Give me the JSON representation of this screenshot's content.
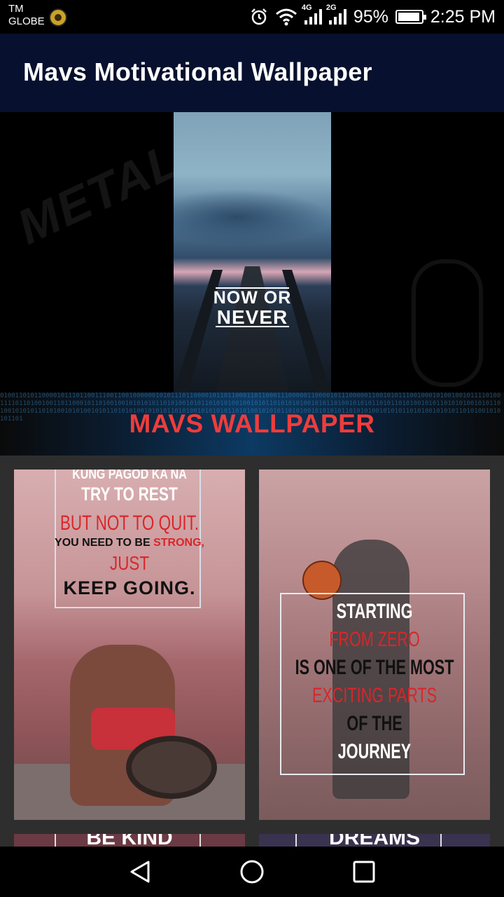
{
  "status_bar": {
    "carrier_line1": "TM",
    "carrier_line2": "GLOBE",
    "net_4g": "4G",
    "net_2g": "2G",
    "battery_percent": "95%",
    "battery_level": 0.95,
    "time": "2:25 PM"
  },
  "app_bar": {
    "title": "Mavs Motivational Wallpaper"
  },
  "hero": {
    "quote_line1": "NOW OR",
    "quote_line2": "NEVER",
    "background_text": "METALLICA"
  },
  "banner": {
    "title": "MAVS WALLPAPER"
  },
  "wallpapers": [
    {
      "lines": [
        "KUNG PAGOD KA NA",
        "TRY TO REST",
        "BUT NOT TO QUIT.",
        "YOU NEED TO BE",
        "STRONG,",
        "JUST",
        "KEEP GOING."
      ]
    },
    {
      "lines": [
        "STARTING",
        "FROM ZERO",
        "IS ONE OF THE MOST",
        "EXCITING PARTS",
        "OF THE",
        "JOURNEY"
      ]
    },
    {
      "lines": [
        "BE KIND"
      ]
    },
    {
      "lines": [
        "DREAMS"
      ]
    }
  ],
  "nav": {
    "back_icon": "back-icon",
    "home_icon": "home-icon",
    "recent_icon": "recent-apps-icon"
  }
}
